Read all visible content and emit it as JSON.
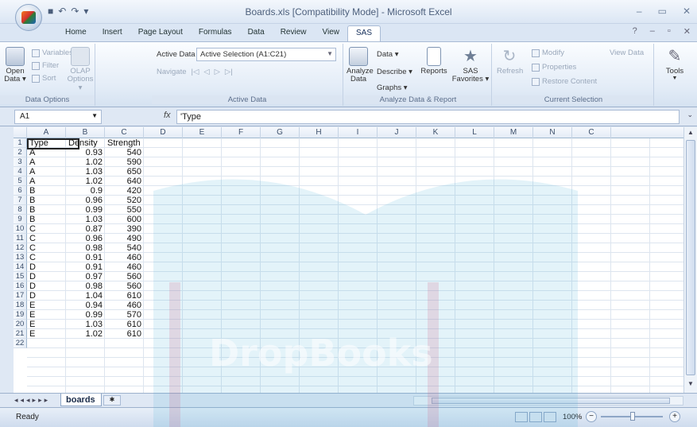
{
  "window": {
    "title": "Boards.xls  [Compatibility Mode] - Microsoft Excel"
  },
  "tabs": [
    "Home",
    "Insert",
    "Page Layout",
    "Formulas",
    "Data",
    "Review",
    "View",
    "SAS"
  ],
  "active_tab": "SAS",
  "ribbon": {
    "data_options": {
      "label": "Data Options",
      "open": "Open Data ▾",
      "variables": "Variables",
      "filter": "Filter",
      "sort": "Sort",
      "olap": "OLAP Options ▾"
    },
    "active_data": {
      "label": "Active Data",
      "field_label": "Active Data",
      "selection": "Active Selection (A1:C21)",
      "navigate": "Navigate"
    },
    "analyze": {
      "label": "Analyze Data & Report",
      "analyze_data": "Analyze Data",
      "data": "Data ▾",
      "describe": "Describe ▾",
      "graphs": "Graphs ▾",
      "reports": "Reports",
      "sas_favorites": "SAS Favorites ▾"
    },
    "current_selection": {
      "label": "Current Selection",
      "refresh": "Refresh",
      "modify": "Modify",
      "properties": "Properties",
      "restore": "Restore Content",
      "view_data": "View Data"
    },
    "tools": "Tools"
  },
  "formula_bar": {
    "name_box": "A1",
    "fx": "fx",
    "content": "'Type"
  },
  "columns": [
    "A",
    "B",
    "C",
    "D",
    "E",
    "F",
    "G",
    "H",
    "I",
    "J",
    "K",
    "L",
    "M",
    "N",
    "C"
  ],
  "rows": [
    {
      "n": "1",
      "a": "Type",
      "b": "Density",
      "c": "Strength"
    },
    {
      "n": "2",
      "a": "A",
      "b": "0.93",
      "c": "540"
    },
    {
      "n": "3",
      "a": "A",
      "b": "1.02",
      "c": "590"
    },
    {
      "n": "4",
      "a": "A",
      "b": "1.03",
      "c": "650"
    },
    {
      "n": "5",
      "a": "A",
      "b": "1.02",
      "c": "640"
    },
    {
      "n": "6",
      "a": "B",
      "b": "0.9",
      "c": "420"
    },
    {
      "n": "7",
      "a": "B",
      "b": "0.96",
      "c": "520"
    },
    {
      "n": "8",
      "a": "B",
      "b": "0.99",
      "c": "550"
    },
    {
      "n": "9",
      "a": "B",
      "b": "1.03",
      "c": "600"
    },
    {
      "n": "10",
      "a": "C",
      "b": "0.87",
      "c": "390"
    },
    {
      "n": "11",
      "a": "C",
      "b": "0.96",
      "c": "490"
    },
    {
      "n": "12",
      "a": "C",
      "b": "0.98",
      "c": "540"
    },
    {
      "n": "13",
      "a": "C",
      "b": "0.91",
      "c": "460"
    },
    {
      "n": "14",
      "a": "D",
      "b": "0.91",
      "c": "460"
    },
    {
      "n": "15",
      "a": "D",
      "b": "0.97",
      "c": "560"
    },
    {
      "n": "16",
      "a": "D",
      "b": "0.98",
      "c": "560"
    },
    {
      "n": "17",
      "a": "D",
      "b": "1.04",
      "c": "610"
    },
    {
      "n": "18",
      "a": "E",
      "b": "0.94",
      "c": "460"
    },
    {
      "n": "19",
      "a": "E",
      "b": "0.99",
      "c": "570"
    },
    {
      "n": "20",
      "a": "E",
      "b": "1.03",
      "c": "610"
    },
    {
      "n": "21",
      "a": "E",
      "b": "1.02",
      "c": "610"
    },
    {
      "n": "22",
      "a": "",
      "b": "",
      "c": ""
    }
  ],
  "sheet_tab": "boards",
  "status": {
    "text": "Ready",
    "zoom": "100%"
  },
  "watermark": "DropBooks"
}
